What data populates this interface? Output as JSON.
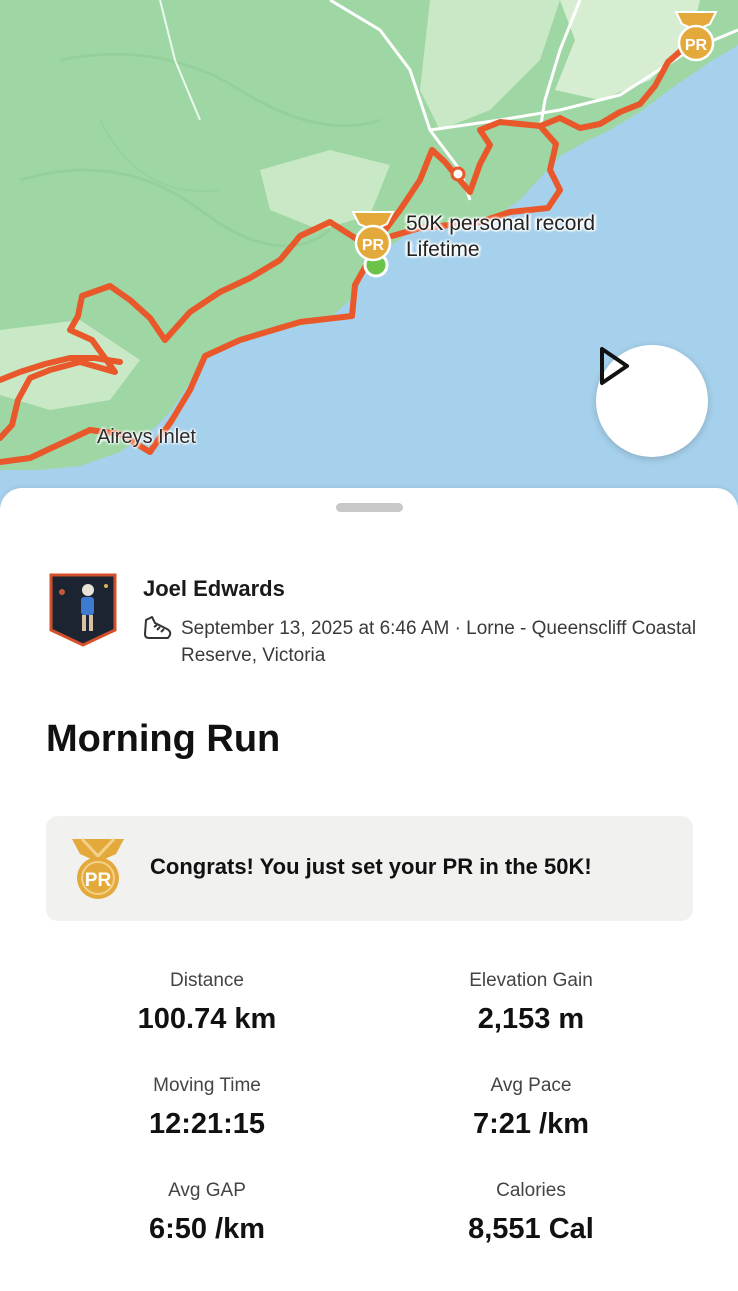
{
  "map": {
    "colors": {
      "land": "#9ed7a4",
      "water": "#a6d1ec",
      "route": "#e8582a",
      "road": "#ffffff"
    },
    "place_label": "Aireys Inlet",
    "pr_marker": {
      "title": "50K personal record",
      "subtitle": "Lifetime",
      "badge": "PR"
    },
    "corner_badge": "PR",
    "start_marker_color": "#6cc34a",
    "play_button_icon": "play-icon"
  },
  "athlete": {
    "name": "Joel Edwards",
    "activity_icon": "run-shoe-icon",
    "meta": "September 13, 2025 at 6:46 AM · Lorne - Queenscliff Coastal Reserve, Victoria"
  },
  "activity": {
    "title": "Morning Run",
    "congrats": {
      "badge": "PR",
      "text": "Congrats! You just set your PR in the 50K!"
    }
  },
  "stats": [
    {
      "label": "Distance",
      "value": "100.74 km"
    },
    {
      "label": "Elevation Gain",
      "value": "2,153 m"
    },
    {
      "label": "Moving Time",
      "value": "12:21:15"
    },
    {
      "label": "Avg Pace",
      "value": "7:21 /km"
    },
    {
      "label": "Avg GAP",
      "value": "6:50 /km"
    },
    {
      "label": "Calories",
      "value": "8,551 Cal"
    }
  ]
}
